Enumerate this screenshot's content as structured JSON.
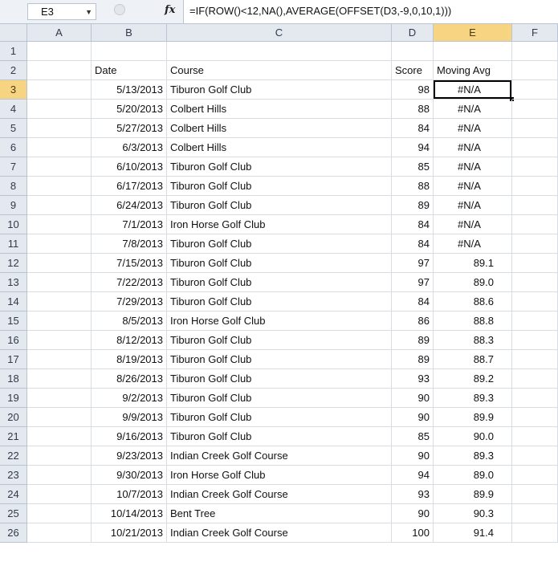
{
  "formula_bar": {
    "name_box": "E3",
    "fx_label": "fx",
    "formula": "=IF(ROW()<12,NA(),AVERAGE(OFFSET(D3,-9,0,10,1)))"
  },
  "columns": [
    "A",
    "B",
    "C",
    "D",
    "E",
    "F"
  ],
  "active_cell": "E3",
  "header_row": {
    "date": "Date",
    "course": "Course",
    "score": "Score",
    "moving_avg": "Moving Avg"
  },
  "rows": [
    {
      "row": "3",
      "date": "5/13/2013",
      "course": "Tiburon Golf Club",
      "score": "98",
      "avg": "#N/A"
    },
    {
      "row": "4",
      "date": "5/20/2013",
      "course": "Colbert Hills",
      "score": "88",
      "avg": "#N/A"
    },
    {
      "row": "5",
      "date": "5/27/2013",
      "course": "Colbert Hills",
      "score": "84",
      "avg": "#N/A"
    },
    {
      "row": "6",
      "date": "6/3/2013",
      "course": "Colbert Hills",
      "score": "94",
      "avg": "#N/A"
    },
    {
      "row": "7",
      "date": "6/10/2013",
      "course": "Tiburon Golf Club",
      "score": "85",
      "avg": "#N/A"
    },
    {
      "row": "8",
      "date": "6/17/2013",
      "course": "Tiburon Golf Club",
      "score": "88",
      "avg": "#N/A"
    },
    {
      "row": "9",
      "date": "6/24/2013",
      "course": "Tiburon Golf Club",
      "score": "89",
      "avg": "#N/A"
    },
    {
      "row": "10",
      "date": "7/1/2013",
      "course": "Iron Horse Golf Club",
      "score": "84",
      "avg": "#N/A"
    },
    {
      "row": "11",
      "date": "7/8/2013",
      "course": "Tiburon Golf Club",
      "score": "84",
      "avg": "#N/A"
    },
    {
      "row": "12",
      "date": "7/15/2013",
      "course": "Tiburon Golf Club",
      "score": "97",
      "avg": "89.1"
    },
    {
      "row": "13",
      "date": "7/22/2013",
      "course": "Tiburon Golf Club",
      "score": "97",
      "avg": "89.0"
    },
    {
      "row": "14",
      "date": "7/29/2013",
      "course": "Tiburon Golf Club",
      "score": "84",
      "avg": "88.6"
    },
    {
      "row": "15",
      "date": "8/5/2013",
      "course": "Iron Horse Golf Club",
      "score": "86",
      "avg": "88.8"
    },
    {
      "row": "16",
      "date": "8/12/2013",
      "course": "Tiburon Golf Club",
      "score": "89",
      "avg": "88.3"
    },
    {
      "row": "17",
      "date": "8/19/2013",
      "course": "Tiburon Golf Club",
      "score": "89",
      "avg": "88.7"
    },
    {
      "row": "18",
      "date": "8/26/2013",
      "course": "Tiburon Golf Club",
      "score": "93",
      "avg": "89.2"
    },
    {
      "row": "19",
      "date": "9/2/2013",
      "course": "Tiburon Golf Club",
      "score": "90",
      "avg": "89.3"
    },
    {
      "row": "20",
      "date": "9/9/2013",
      "course": "Tiburon Golf Club",
      "score": "90",
      "avg": "89.9"
    },
    {
      "row": "21",
      "date": "9/16/2013",
      "course": "Tiburon Golf Club",
      "score": "85",
      "avg": "90.0"
    },
    {
      "row": "22",
      "date": "9/23/2013",
      "course": "Indian Creek Golf Course",
      "score": "90",
      "avg": "89.3"
    },
    {
      "row": "23",
      "date": "9/30/2013",
      "course": "Iron Horse Golf Club",
      "score": "94",
      "avg": "89.0"
    },
    {
      "row": "24",
      "date": "10/7/2013",
      "course": "Indian Creek Golf Course",
      "score": "93",
      "avg": "89.9"
    },
    {
      "row": "25",
      "date": "10/14/2013",
      "course": "Bent Tree",
      "score": "90",
      "avg": "90.3"
    },
    {
      "row": "26",
      "date": "10/21/2013",
      "course": "Indian Creek Golf Course",
      "score": "100",
      "avg": "91.4"
    }
  ]
}
